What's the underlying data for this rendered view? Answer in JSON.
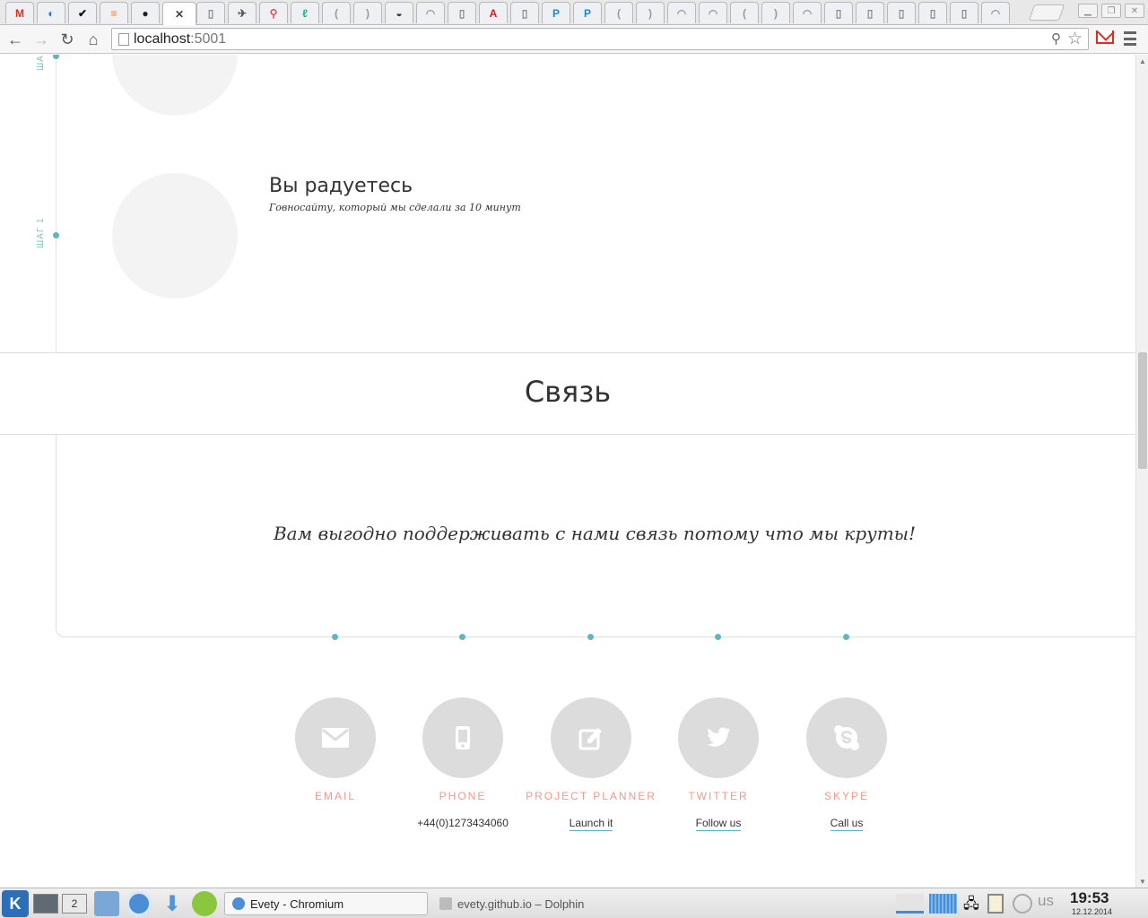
{
  "browser": {
    "tabs": [
      {
        "icon": "gmail-icon",
        "glyph": "M",
        "color": "#d93025"
      },
      {
        "icon": "map-pin-icon",
        "glyph": "◐",
        "color": "#1a73e8"
      },
      {
        "icon": "checkmark-icon",
        "glyph": "✔",
        "color": "#111111"
      },
      {
        "icon": "stack-overflow-icon",
        "glyph": "≡",
        "color": "#f48024"
      },
      {
        "icon": "github-icon",
        "glyph": "●",
        "color": "#222222"
      },
      {
        "icon": "close-icon",
        "glyph": "✕",
        "color": "#444444",
        "active": true
      },
      {
        "icon": "page-icon",
        "glyph": "▯",
        "color": "#888888"
      },
      {
        "icon": "bird-icon",
        "glyph": "✈",
        "color": "#555555"
      },
      {
        "icon": "location-icon",
        "glyph": "⚲",
        "color": "#e05050"
      },
      {
        "icon": "leaf-icon",
        "glyph": "ℓ",
        "color": "#1db99a"
      },
      {
        "icon": "loading-icon",
        "glyph": "(",
        "color": "#999999"
      },
      {
        "icon": "loading-icon",
        "glyph": ")",
        "color": "#999999"
      },
      {
        "icon": "bowl-icon",
        "glyph": "◒",
        "color": "#333333"
      },
      {
        "icon": "loading-icon",
        "glyph": "◠",
        "color": "#999999"
      },
      {
        "icon": "page-icon",
        "glyph": "▯",
        "color": "#888888"
      },
      {
        "icon": "angular-icon",
        "glyph": "A",
        "color": "#dd1b16"
      },
      {
        "icon": "page-icon",
        "glyph": "▯",
        "color": "#888888"
      },
      {
        "icon": "p-icon",
        "glyph": "P",
        "color": "#1d88c9"
      },
      {
        "icon": "p-icon",
        "glyph": "P",
        "color": "#1d88c9"
      },
      {
        "icon": "loading-icon",
        "glyph": "(",
        "color": "#999999"
      },
      {
        "icon": "loading-icon",
        "glyph": ")",
        "color": "#999999"
      },
      {
        "icon": "loading-icon",
        "glyph": "◠",
        "color": "#999999"
      },
      {
        "icon": "loading-icon",
        "glyph": "◠",
        "color": "#999999"
      },
      {
        "icon": "loading-icon",
        "glyph": "(",
        "color": "#999999"
      },
      {
        "icon": "loading-icon",
        "glyph": ")",
        "color": "#999999"
      },
      {
        "icon": "loading-icon",
        "glyph": "◠",
        "color": "#999999"
      },
      {
        "icon": "page-icon",
        "glyph": "▯",
        "color": "#888888"
      },
      {
        "icon": "page-icon",
        "glyph": "▯",
        "color": "#888888"
      },
      {
        "icon": "page-icon",
        "glyph": "▯",
        "color": "#888888"
      },
      {
        "icon": "page-icon",
        "glyph": "▯",
        "color": "#888888"
      },
      {
        "icon": "page-icon",
        "glyph": "▯",
        "color": "#888888"
      },
      {
        "icon": "loading-icon",
        "glyph": "◠",
        "color": "#999999"
      }
    ],
    "url_host": "localhost",
    "url_port": ":5001"
  },
  "page": {
    "step_label": "ШАГ 1",
    "step_label_top": "ШАГ",
    "step_title": "Вы радуетесь",
    "step_description": "Говносайту, который мы сделали за 10 минут",
    "section_title": "Связь",
    "contact_lead": "Вам выгодно поддерживать с нами связь потому что мы круты!",
    "accent_color": "#5db7c2",
    "label_color": "#f09a8c",
    "contacts": [
      {
        "label": "EMAIL",
        "detail": "",
        "icon": "envelope-icon"
      },
      {
        "label": "PHONE",
        "detail": "+44(0)1273434060",
        "icon": "phone-icon"
      },
      {
        "label": "PROJECT PLANNER",
        "detail": "Launch it",
        "icon": "edit-icon"
      },
      {
        "label": "TWITTER",
        "detail": "Follow us",
        "icon": "twitter-icon"
      },
      {
        "label": "SKYPE",
        "detail": "Call us",
        "icon": "skype-icon"
      }
    ]
  },
  "taskbar": {
    "desktop_number": "2",
    "tasks": [
      {
        "label": "Evety - Chromium",
        "icon": "chromium-icon",
        "active": true
      },
      {
        "label": "evety.github.io – Dolphin",
        "icon": "dolphin-icon",
        "active": false
      }
    ],
    "keyboard_layout": "us",
    "clock_time": "19:53",
    "clock_date": "12.12.2014"
  }
}
